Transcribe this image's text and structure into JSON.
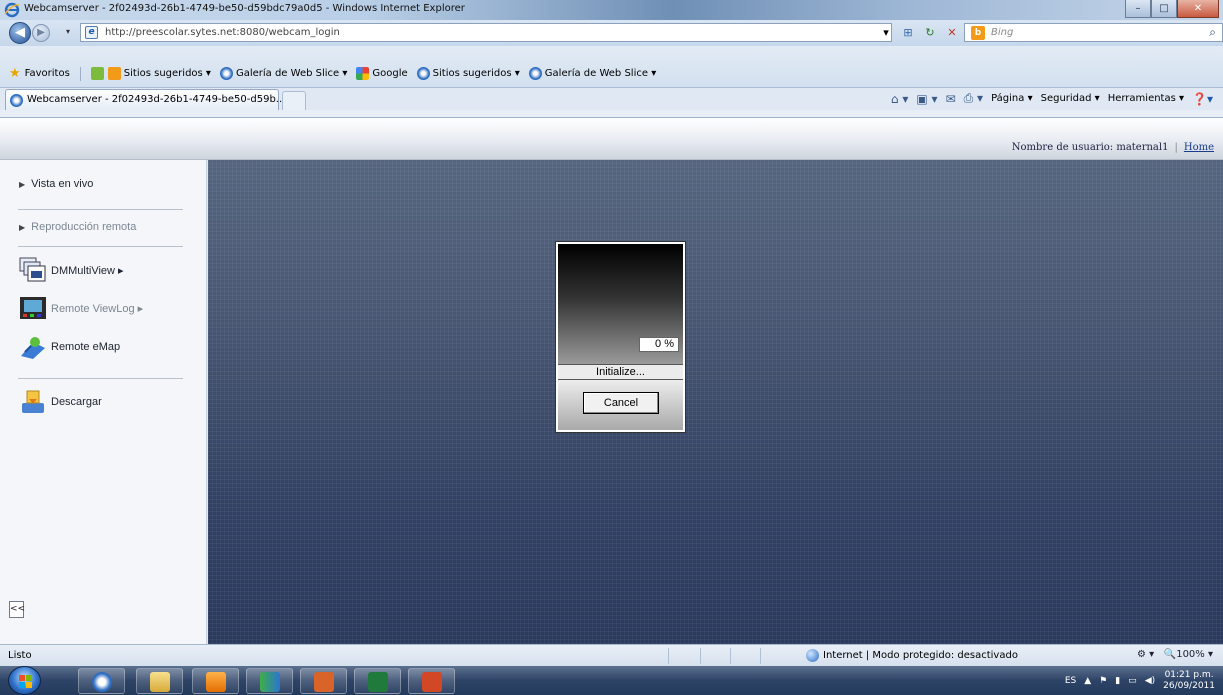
{
  "window": {
    "title": "Webcamserver - 2f02493d-26b1-4749-be50-d59bdc79a0d5 - Windows Internet Explorer",
    "minimize_icon": "minimize-icon",
    "maximize_icon": "maximize-icon",
    "close_icon": "close-icon"
  },
  "address_bar": {
    "url": "http://preescolar.sytes.net:8080/webcam_login",
    "search_placeholder": "Bing"
  },
  "favorites_bar": {
    "label": "Favoritos",
    "items": [
      {
        "label": "Sitios sugeridos ▾",
        "icon": "bing-icon"
      },
      {
        "label": "Galería de Web Slice ▾",
        "icon": "ie-icon"
      },
      {
        "label": "Google",
        "icon": "google-icon"
      },
      {
        "label": "Sitios sugeridos ▾",
        "icon": "ie-icon"
      },
      {
        "label": "Galería de Web Slice ▾",
        "icon": "ie-icon"
      }
    ]
  },
  "tab": {
    "label": "Webcamserver - 2f02493d-26b1-4749-be50-d59b..."
  },
  "command_bar": {
    "page": "Página ▾",
    "security": "Seguridad ▾",
    "tools": "Herramientas ▾"
  },
  "page_header": {
    "user_label": "Nombre de usuario: maternal1",
    "home_link": "Home"
  },
  "sidebar": {
    "live_view": "Vista en vivo",
    "remote_playback": "Reproducción remota",
    "multiview": "DMMultiView ▸",
    "viewlog": "Remote ViewLog ▸",
    "emap": "Remote eMap",
    "download": "Descargar",
    "collapse": "<<"
  },
  "dialog": {
    "percent": "0 %",
    "status": "Initialize...",
    "cancel_label": "Cancel"
  },
  "status_bar": {
    "text": "Listo",
    "zone": "Internet | Modo protegido: desactivado",
    "zoom": "100%"
  },
  "taskbar": {
    "lang": "ES",
    "time": "01:21 p.m.",
    "date": "26/09/2011"
  }
}
